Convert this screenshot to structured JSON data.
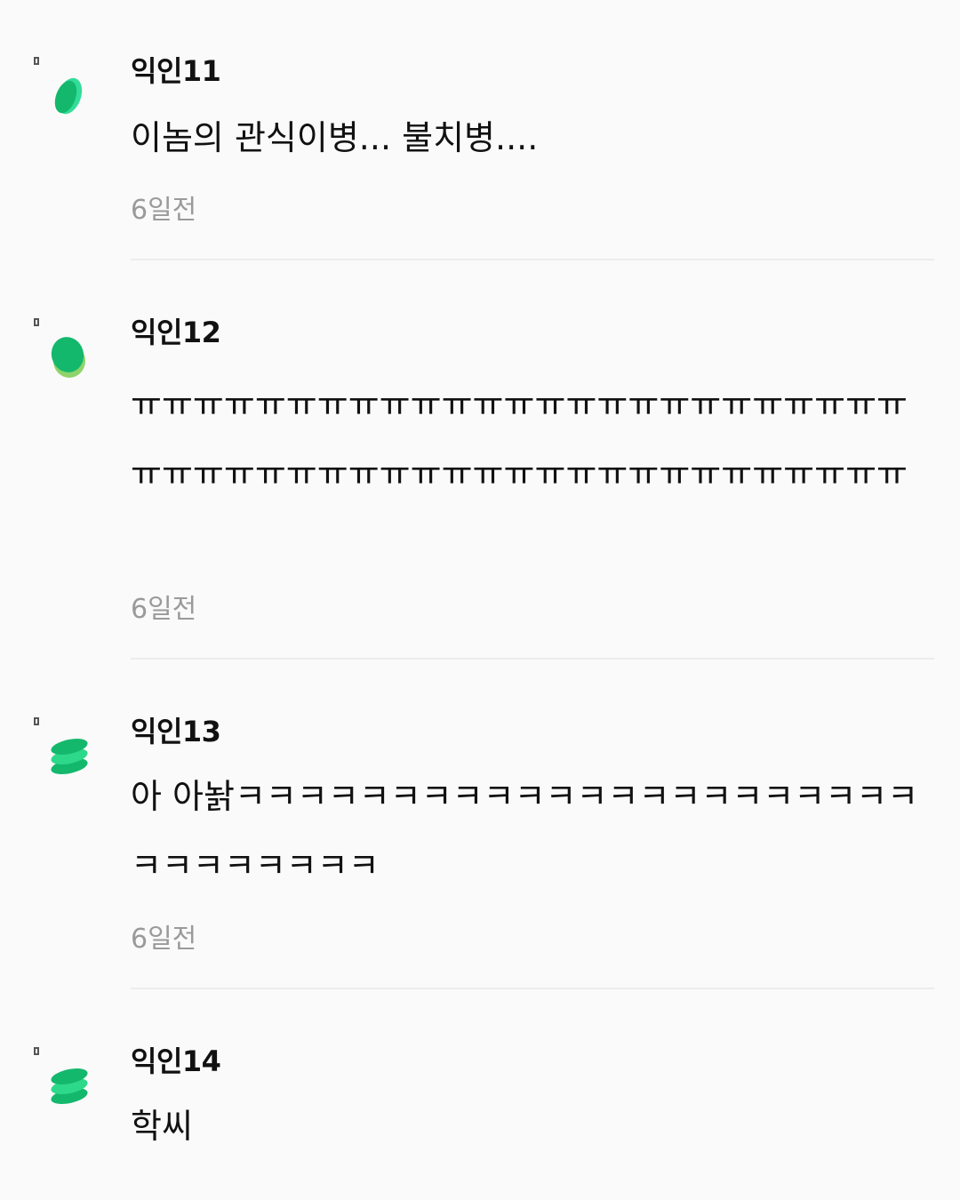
{
  "comments": [
    {
      "author": "익인11",
      "text": "이놈의 관식이병... 불치병....",
      "time": "6일전",
      "avatar_icon": "green-leaf-icon"
    },
    {
      "author": "익인12",
      "text": "ㅠㅠㅠㅠㅠㅠㅠㅠㅠㅠㅠㅠㅠㅠㅠㅠㅠㅠㅠㅠㅠㅠㅠㅠㅠㅠㅠㅠㅠㅠㅠㅠㅠㅠㅠㅠㅠㅠㅠㅠㅠㅠㅠㅠㅠㅠㅠㅠㅠㅠ",
      "time": "6일전",
      "avatar_icon": "green-stack-icon"
    },
    {
      "author": "익인13",
      "text": "아 아놝ㅋㅋㅋㅋㅋㅋㅋㅋㅋㅋㅋㅋㅋㅋㅋㅋㅋㅋㅋㅋㅋㅋㅋㅋㅋㅋㅋㅋㅋㅋ",
      "time": "6일전",
      "avatar_icon": "green-layers-icon"
    },
    {
      "author": "익인14",
      "text": "학씨",
      "time": "",
      "avatar_icon": "green-layers-icon"
    }
  ],
  "colors": {
    "accent_green": "#1ec27a",
    "light_green": "#8fd36b",
    "muted_text": "#9a9a9a"
  }
}
